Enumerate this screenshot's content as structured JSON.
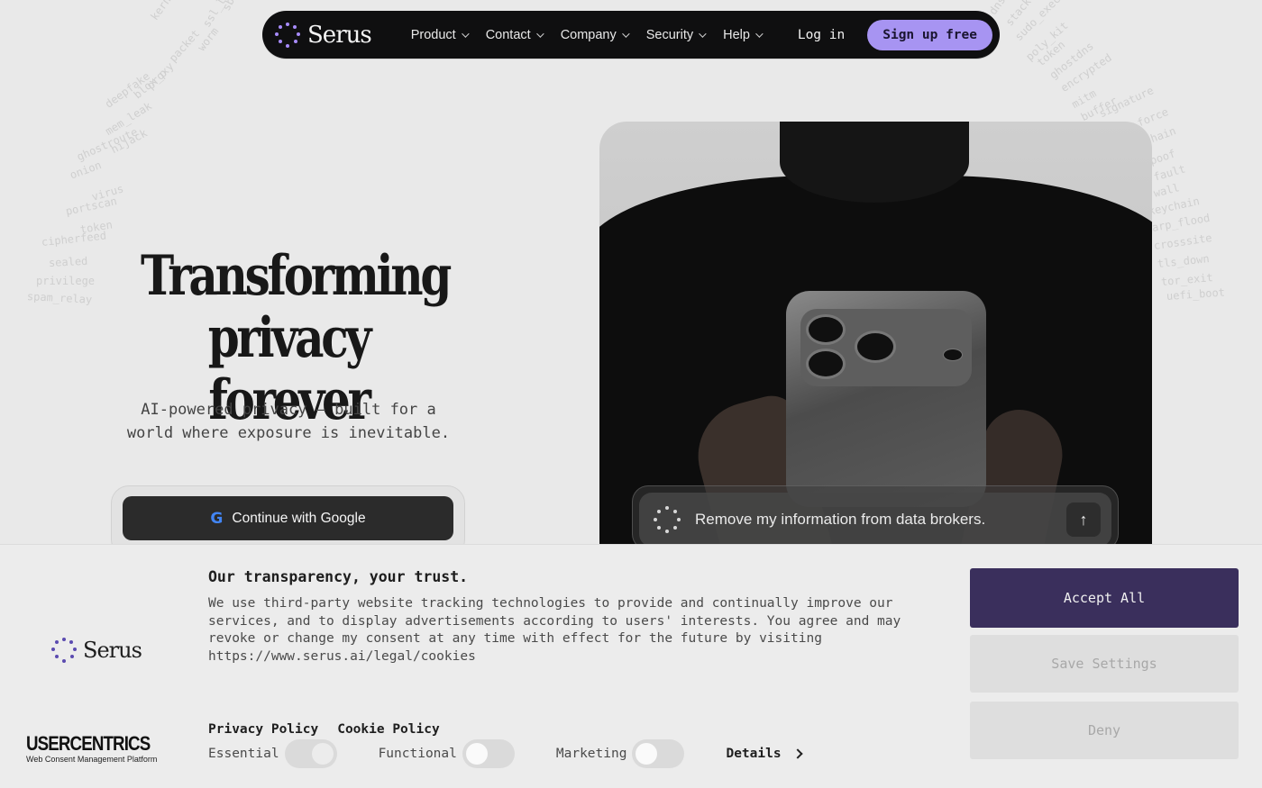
{
  "nav": {
    "brand": "Serus",
    "links": [
      "Product",
      "Contact",
      "Company",
      "Security",
      "Help"
    ],
    "login": "Log in",
    "signup": "Sign up free"
  },
  "hero": {
    "title_line1": "Transforming",
    "title_line2": "privacy forever",
    "subtitle_line1": "AI-powered privacy — built for a",
    "subtitle_line2": "world where exposure is inevitable.",
    "google_cta": "Continue with Google",
    "google_icon": "google-g-icon"
  },
  "prompt": {
    "text": "Remove my information from data brokers.",
    "send_icon": "arrow-up-icon"
  },
  "decor_words_left": [
    "sbfe",
    "ssl_lib",
    "worm",
    "kernel_panic",
    "packet",
    "proxy",
    "blox_p",
    "deepfake",
    "mem_leak",
    "hijack",
    "ghostroute",
    "onion",
    "virus",
    "portscan",
    "token",
    "cipherfeed",
    "sealed",
    "privilege",
    "spam_relay"
  ],
  "decor_words_right": [
    "dns",
    "stack",
    "sudo_exec",
    "poly_kit",
    "token",
    "ghostdns",
    "encrypted",
    "mitm",
    "buffer",
    "signature",
    "force",
    "chain",
    "poof",
    "fault",
    "wall",
    "keychain",
    "arp_flood",
    "crosssite",
    "tls_down",
    "tor_exit",
    "uefi_boot"
  ],
  "consent": {
    "brand": "Serus",
    "uc_name": "USERCENTRICS",
    "uc_tagline": "Web Consent Management Platform",
    "title": "Our transparency, your trust.",
    "body": "We use third-party website tracking technologies to provide and continually improve our services, and to display advertisements according to users' interests. You agree and may revoke or change my consent at any time with effect for the future by visiting https://www.serus.ai/legal/cookies",
    "privacy_policy": "Privacy Policy",
    "cookie_policy": "Cookie Policy",
    "toggles": [
      {
        "label": "Essential",
        "state": "on"
      },
      {
        "label": "Functional",
        "state": "off"
      },
      {
        "label": "Marketing",
        "state": "off"
      }
    ],
    "details": "Details",
    "accept": "Accept All",
    "save": "Save Settings",
    "deny": "Deny"
  },
  "colors": {
    "brand_purple": "#a794f2",
    "accept_bg": "#3a2f5c",
    "nav_bg": "#0f0f10"
  }
}
